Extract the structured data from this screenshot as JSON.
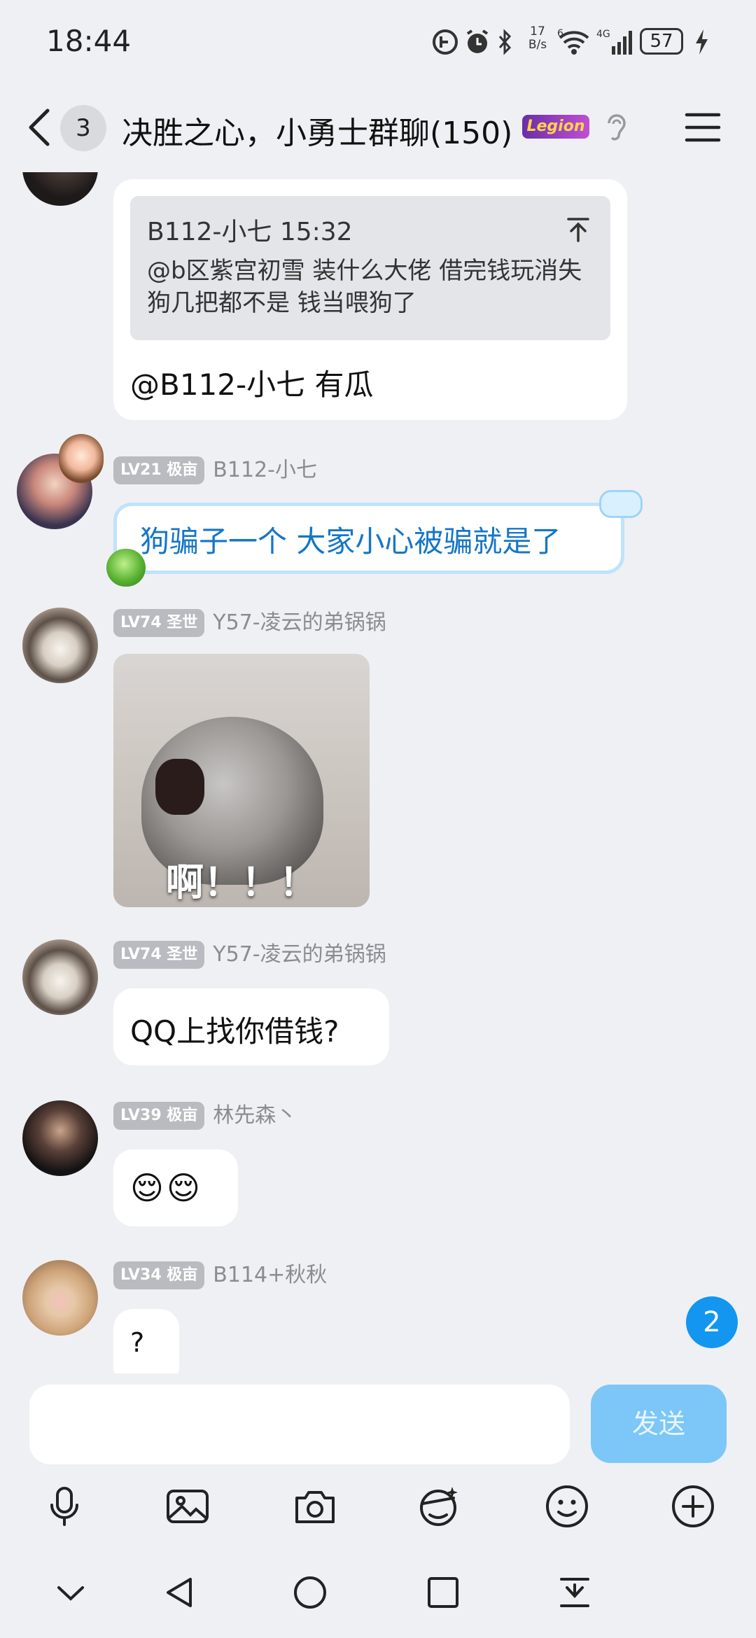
{
  "status_bar": {
    "time": "18:44",
    "net_speed_value": "17",
    "net_speed_unit": "B/s",
    "wifi_label": "6",
    "cell_label": "4G",
    "battery": "57"
  },
  "header": {
    "unread_count": "3",
    "title": "决胜之心，小勇士群聊(150)",
    "badge": "Legion"
  },
  "messages": {
    "m1": {
      "quote_author": "B112-小七 15:32",
      "quote_text": "@b区紫宫初雪 装什么大佬  借完钱玩消失  狗几把都不是 钱当喂狗了",
      "text": "@B112-小七 有瓜"
    },
    "m2": {
      "level": "LV21 极亩",
      "name": "B112-小七",
      "text": "狗骗子一个 大家小心被骗就是了"
    },
    "m3": {
      "level": "LV74 圣世",
      "name": "Y57-凌云的弟锅锅",
      "image_caption": "啊！！！"
    },
    "m4": {
      "level": "LV74 圣世",
      "name": "Y57-凌云的弟锅锅",
      "text": "QQ上找你借钱?"
    },
    "m5": {
      "level": "LV39 极亩",
      "name": "林先森丶",
      "emoji": "😌😌"
    },
    "m6": {
      "level": "LV34 极亩",
      "name": "B114+秋秋",
      "text": "?"
    }
  },
  "new_messages_count": "2",
  "input": {
    "placeholder": "",
    "send_label": "发送"
  },
  "colors": {
    "send_button": "#7cc7f8",
    "badge_blue": "#1296f0",
    "bubble_text_blue": "#1576c8"
  }
}
